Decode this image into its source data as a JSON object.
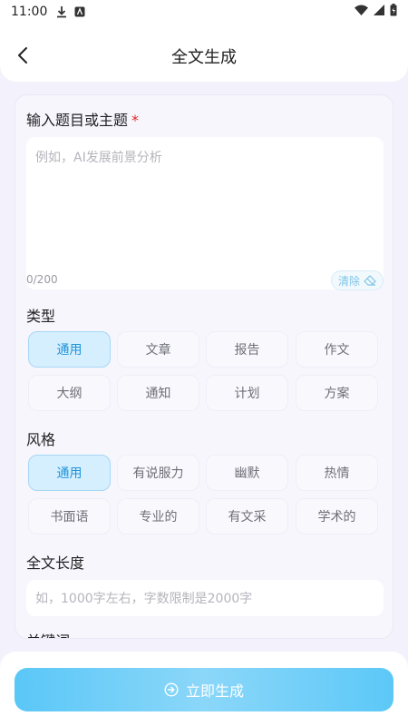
{
  "status": {
    "time": "11:00"
  },
  "header": {
    "title": "全文生成"
  },
  "topic": {
    "label": "输入题目或主题",
    "required_mark": "*",
    "placeholder": "例如，AI发展前景分析",
    "count": "0/200",
    "clear_label": "清除"
  },
  "type": {
    "label": "类型",
    "options": [
      "通用",
      "文章",
      "报告",
      "作文",
      "大纲",
      "通知",
      "计划",
      "方案"
    ],
    "selected": "通用"
  },
  "style": {
    "label": "风格",
    "options": [
      "通用",
      "有说服力",
      "幽默",
      "热情",
      "书面语",
      "专业的",
      "有文采",
      "学术的"
    ],
    "selected": "通用"
  },
  "length": {
    "label": "全文长度",
    "placeholder": "如，1000字左右，字数限制是2000字"
  },
  "keywords": {
    "label": "关键词"
  },
  "action": {
    "generate_label": "立即生成"
  },
  "colors": {
    "accent": "#1e94d8",
    "button": "#5ac7f7",
    "required": "#e02a2a"
  }
}
